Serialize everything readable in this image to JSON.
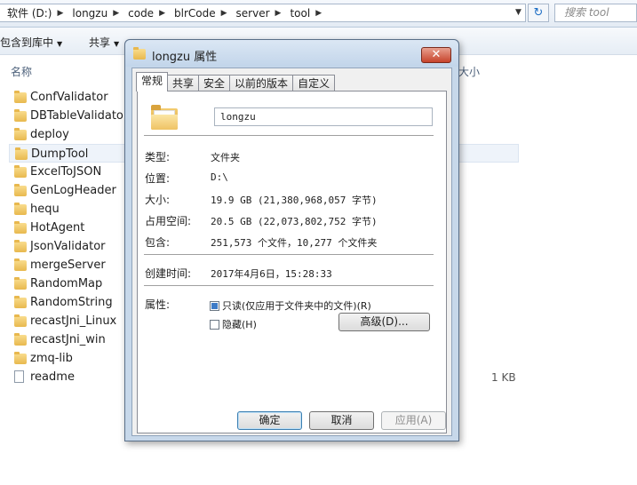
{
  "address_bar": {
    "crumbs": [
      "软件 (D:)",
      "longzu",
      "code",
      "blrCode",
      "server",
      "tool"
    ],
    "search_placeholder": "搜索 tool"
  },
  "toolbar": {
    "include_in_library": "包含到库中",
    "share": "共享"
  },
  "columns": {
    "name": "名称",
    "size": "大小"
  },
  "files": [
    {
      "name": "ConfValidator",
      "type": "folder",
      "size": ""
    },
    {
      "name": "DBTableValidator",
      "type": "folder",
      "size": ""
    },
    {
      "name": "deploy",
      "type": "folder",
      "size": ""
    },
    {
      "name": "DumpTool",
      "type": "folder",
      "size": "",
      "selected": true
    },
    {
      "name": "ExcelToJSON",
      "type": "folder",
      "size": ""
    },
    {
      "name": "GenLogHeader",
      "type": "folder",
      "size": ""
    },
    {
      "name": "hequ",
      "type": "folder",
      "size": ""
    },
    {
      "name": "HotAgent",
      "type": "folder",
      "size": ""
    },
    {
      "name": "JsonValidator",
      "type": "folder",
      "size": ""
    },
    {
      "name": "mergeServer",
      "type": "folder",
      "size": ""
    },
    {
      "name": "RandomMap",
      "type": "folder",
      "size": ""
    },
    {
      "name": "RandomString",
      "type": "folder",
      "size": ""
    },
    {
      "name": "recastJni_Linux",
      "type": "folder",
      "size": ""
    },
    {
      "name": "recastJni_win",
      "type": "folder",
      "size": ""
    },
    {
      "name": "zmq-lib",
      "type": "folder",
      "size": ""
    },
    {
      "name": "readme",
      "type": "file",
      "size": "1 KB"
    }
  ],
  "dialog": {
    "title": "longzu 属性",
    "close": "✕",
    "tabs": [
      "常规",
      "共享",
      "安全",
      "以前的版本",
      "自定义"
    ],
    "active_tab": 0,
    "folder_name": "longzu",
    "props": {
      "type_label": "类型:",
      "type_value": "文件夹",
      "location_label": "位置:",
      "location_value": "D:\\",
      "size_label": "大小:",
      "size_value": "19.9 GB (21,380,968,057 字节)",
      "size_on_disk_label": "占用空间:",
      "size_on_disk_value": "20.5 GB (22,073,802,752 字节)",
      "contains_label": "包含:",
      "contains_value": "251,573 个文件，10,277 个文件夹",
      "created_label": "创建时间:",
      "created_value": "2017年4月6日，15:28:33",
      "attributes_label": "属性:"
    },
    "attributes": {
      "readonly_label": "只读(仅应用于文件夹中的文件)(R)",
      "hidden_label": "隐藏(H)",
      "advanced_label": "高级(D)..."
    },
    "buttons": {
      "ok": "确定",
      "cancel": "取消",
      "apply": "应用(A)"
    }
  }
}
